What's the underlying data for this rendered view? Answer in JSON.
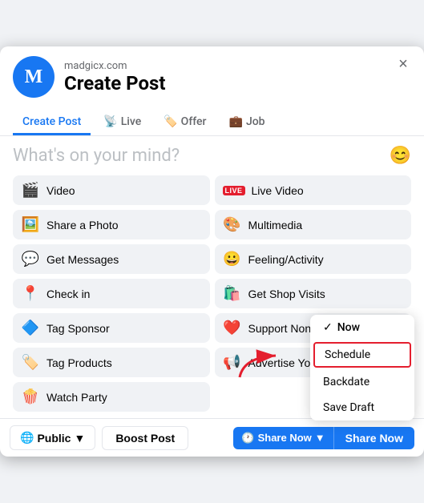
{
  "modal": {
    "site_name": "madgicx.com",
    "title": "Create Post",
    "close_label": "×"
  },
  "tabs": [
    {
      "label": "Create Post",
      "icon": "",
      "active": true
    },
    {
      "label": "Live",
      "icon": "📡",
      "active": false
    },
    {
      "label": "Offer",
      "icon": "🏷️",
      "active": false
    },
    {
      "label": "Job",
      "icon": "💼",
      "active": false
    }
  ],
  "placeholder": "What's on your mind?",
  "actions": [
    {
      "icon": "🎬",
      "label": "Video",
      "col": 1
    },
    {
      "icon": "🔴",
      "label": "Live Video",
      "col": 2,
      "badge": "LIVE"
    },
    {
      "icon": "🖼️",
      "label": "Share a Photo",
      "col": 1
    },
    {
      "icon": "🎨",
      "label": "Multimedia",
      "col": 2
    },
    {
      "icon": "💬",
      "label": "Get Messages",
      "col": 1
    },
    {
      "icon": "😀",
      "label": "Feeling/Activity",
      "col": 2
    },
    {
      "icon": "📍",
      "label": "Check in",
      "col": 1
    },
    {
      "icon": "🛍️",
      "label": "Get Shop Visits",
      "col": 2
    },
    {
      "icon": "🔷",
      "label": "Tag Sponsor",
      "col": 1
    },
    {
      "icon": "❤️",
      "label": "Support Nonprofit",
      "col": 2
    },
    {
      "icon": "🏷️",
      "label": "Tag Products",
      "col": 1
    },
    {
      "icon": "📢",
      "label": "Advertise Your Business",
      "col": 2
    },
    {
      "icon": "🍿",
      "label": "Watch Party",
      "col": 1
    }
  ],
  "footer": {
    "public_label": "Public",
    "boost_label": "Boost Post",
    "share_now_label": "Share Now",
    "share_now_main_label": "Share Now"
  },
  "dropdown": {
    "items": [
      {
        "label": "Now",
        "selected": true,
        "checkmark": "✓"
      },
      {
        "label": "Schedule",
        "highlight": true
      },
      {
        "label": "Backdate",
        "highlight": false
      },
      {
        "label": "Save Draft",
        "highlight": false
      }
    ]
  },
  "icons": {
    "checkmark": "✓",
    "chevron_down": "▼",
    "globe": "🌐",
    "clock": "🕐",
    "emoji": "😊",
    "close": "×"
  }
}
